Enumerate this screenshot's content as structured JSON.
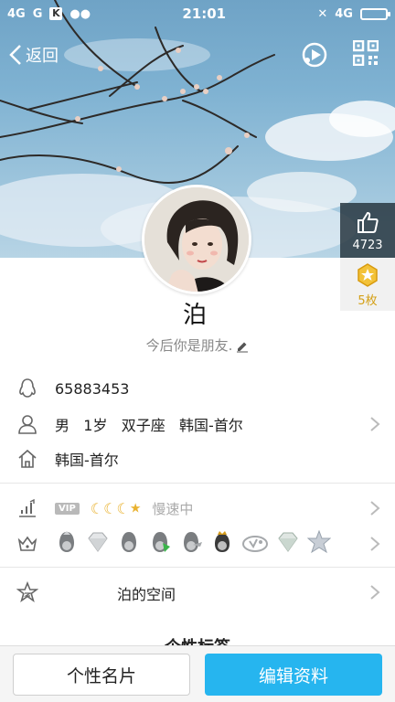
{
  "status_bar": {
    "network_left": "4G",
    "network_left2": "G",
    "time": "21:01",
    "network_right": "4G"
  },
  "nav": {
    "back_label": "返回"
  },
  "like": {
    "count": "4723"
  },
  "badge": {
    "count": "5枚"
  },
  "profile": {
    "nickname": "泊",
    "signature": "今后你是朋友."
  },
  "info": {
    "qq_number": "65883453",
    "gender": "男",
    "age": "1岁",
    "zodiac": "双子座",
    "location": "韩国-首尔",
    "hometown": "韩国-首尔"
  },
  "level": {
    "vip_label": "VIP",
    "speed_text": "慢速中"
  },
  "space": {
    "label": "泊的空间"
  },
  "tags": {
    "title": "个性标签"
  },
  "bottom": {
    "card_button": "个性名片",
    "edit_button": "编辑资料"
  },
  "colors": {
    "accent": "#26b5ef",
    "gold": "#e9b230"
  }
}
